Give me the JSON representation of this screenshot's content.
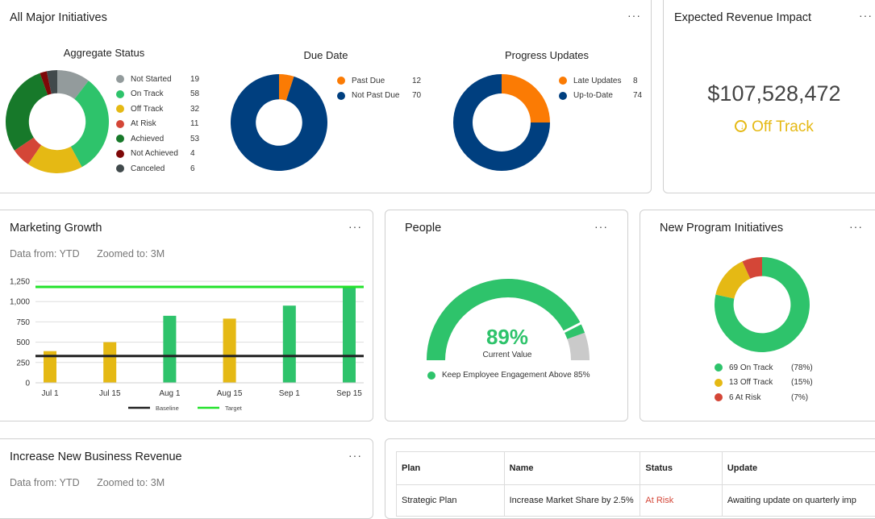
{
  "colors": {
    "on_track": "#2ec36b",
    "off_track": "#e5b914",
    "at_risk": "#d44637",
    "achieved": "#17792a",
    "not_achieved": "#7e0808",
    "canceled": "#414a4c",
    "not_started": "#939b9c",
    "orange": "#fb7b04",
    "navy": "#003f7f",
    "baseline": "#222222",
    "target": "#22e22a",
    "gauge_track": "#cacaca"
  },
  "more_label": "···",
  "major": {
    "title": "All Major Initiatives",
    "aggregate": {
      "title": "Aggregate Status",
      "items": [
        {
          "label": "Not Started",
          "value": 19,
          "color": "#939b9c"
        },
        {
          "label": "On Track",
          "value": 58,
          "color": "#2ec36b"
        },
        {
          "label": "Off Track",
          "value": 32,
          "color": "#e5b914"
        },
        {
          "label": "At Risk",
          "value": 11,
          "color": "#d44637"
        },
        {
          "label": "Achieved",
          "value": 53,
          "color": "#17792a"
        },
        {
          "label": "Not Achieved",
          "value": 4,
          "color": "#7e0808"
        },
        {
          "label": "Canceled",
          "value": 6,
          "color": "#414a4c"
        }
      ]
    },
    "due_date": {
      "title": "Due Date",
      "items": [
        {
          "label": "Past Due",
          "value": 12,
          "color": "#fb7b04",
          "shown_fraction": 0.05
        },
        {
          "label": "Not Past Due",
          "value": 70,
          "color": "#003f7f",
          "shown_fraction": 0.95
        }
      ]
    },
    "progress": {
      "title": "Progress Updates",
      "items": [
        {
          "label": "Late Updates",
          "value": 8,
          "color": "#fb7b04",
          "shown_fraction": 0.25
        },
        {
          "label": "Up-to-Date",
          "value": 74,
          "color": "#003f7f",
          "shown_fraction": 0.75
        }
      ]
    }
  },
  "revenue": {
    "title": "Expected Revenue Impact",
    "value": "$107,528,472",
    "status": "Off Track",
    "status_icon": "⊕"
  },
  "marketing": {
    "title": "Marketing Growth",
    "data_from": "Data from: YTD",
    "zoomed_to": "Zoomed to: 3M"
  },
  "chart_data": {
    "type": "bar",
    "title": "Marketing Growth",
    "categories": [
      "Jul 1",
      "Jul 15",
      "Aug 1",
      "Aug 15",
      "Sep 1",
      "Sep 15"
    ],
    "values": [
      390,
      500,
      825,
      790,
      950,
      1170
    ],
    "bar_status": [
      "off_track",
      "off_track",
      "on_track",
      "off_track",
      "on_track",
      "on_track"
    ],
    "reference_lines": [
      {
        "name": "Baseline",
        "value": 330
      },
      {
        "name": "Target",
        "value": 1180
      }
    ],
    "yticks": [
      0,
      250,
      500,
      750,
      1000,
      1250
    ],
    "ytick_labels": [
      "0",
      "250",
      "500",
      "750",
      "1,000",
      "1,250"
    ],
    "ylim": [
      0,
      1250
    ],
    "grid": true,
    "legend_position": "bottom",
    "xlabel": "",
    "ylabel": ""
  },
  "people": {
    "title": "People",
    "value": 89,
    "value_label": "89%",
    "target": 85,
    "caption": "Current Value",
    "legend": "Keep Employee Engagement Above 85%"
  },
  "new_program": {
    "title": "New Program Initiatives",
    "items": [
      {
        "count": "69",
        "label": "69 On Track",
        "pct": "(78%)",
        "value": 69,
        "color": "#2ec36b"
      },
      {
        "count": "13",
        "label": "13 Off Track",
        "pct": "(15%)",
        "value": 13,
        "color": "#e5b914"
      },
      {
        "count": "6",
        "label": "6 At Risk",
        "pct": "(7%)",
        "value": 6,
        "color": "#d44637"
      }
    ]
  },
  "business": {
    "title": "Increase New Business Revenue",
    "data_from": "Data from: YTD",
    "zoomed_to": "Zoomed to: 3M"
  },
  "table": {
    "headers": [
      "Plan",
      "Name",
      "Status",
      "Update"
    ],
    "rows": [
      {
        "plan": "Strategic Plan",
        "name": "Increase Market Share by 2.5%",
        "status": "At Risk",
        "status_color": "#d44637",
        "update": "Awaiting update on quarterly imp"
      }
    ]
  }
}
